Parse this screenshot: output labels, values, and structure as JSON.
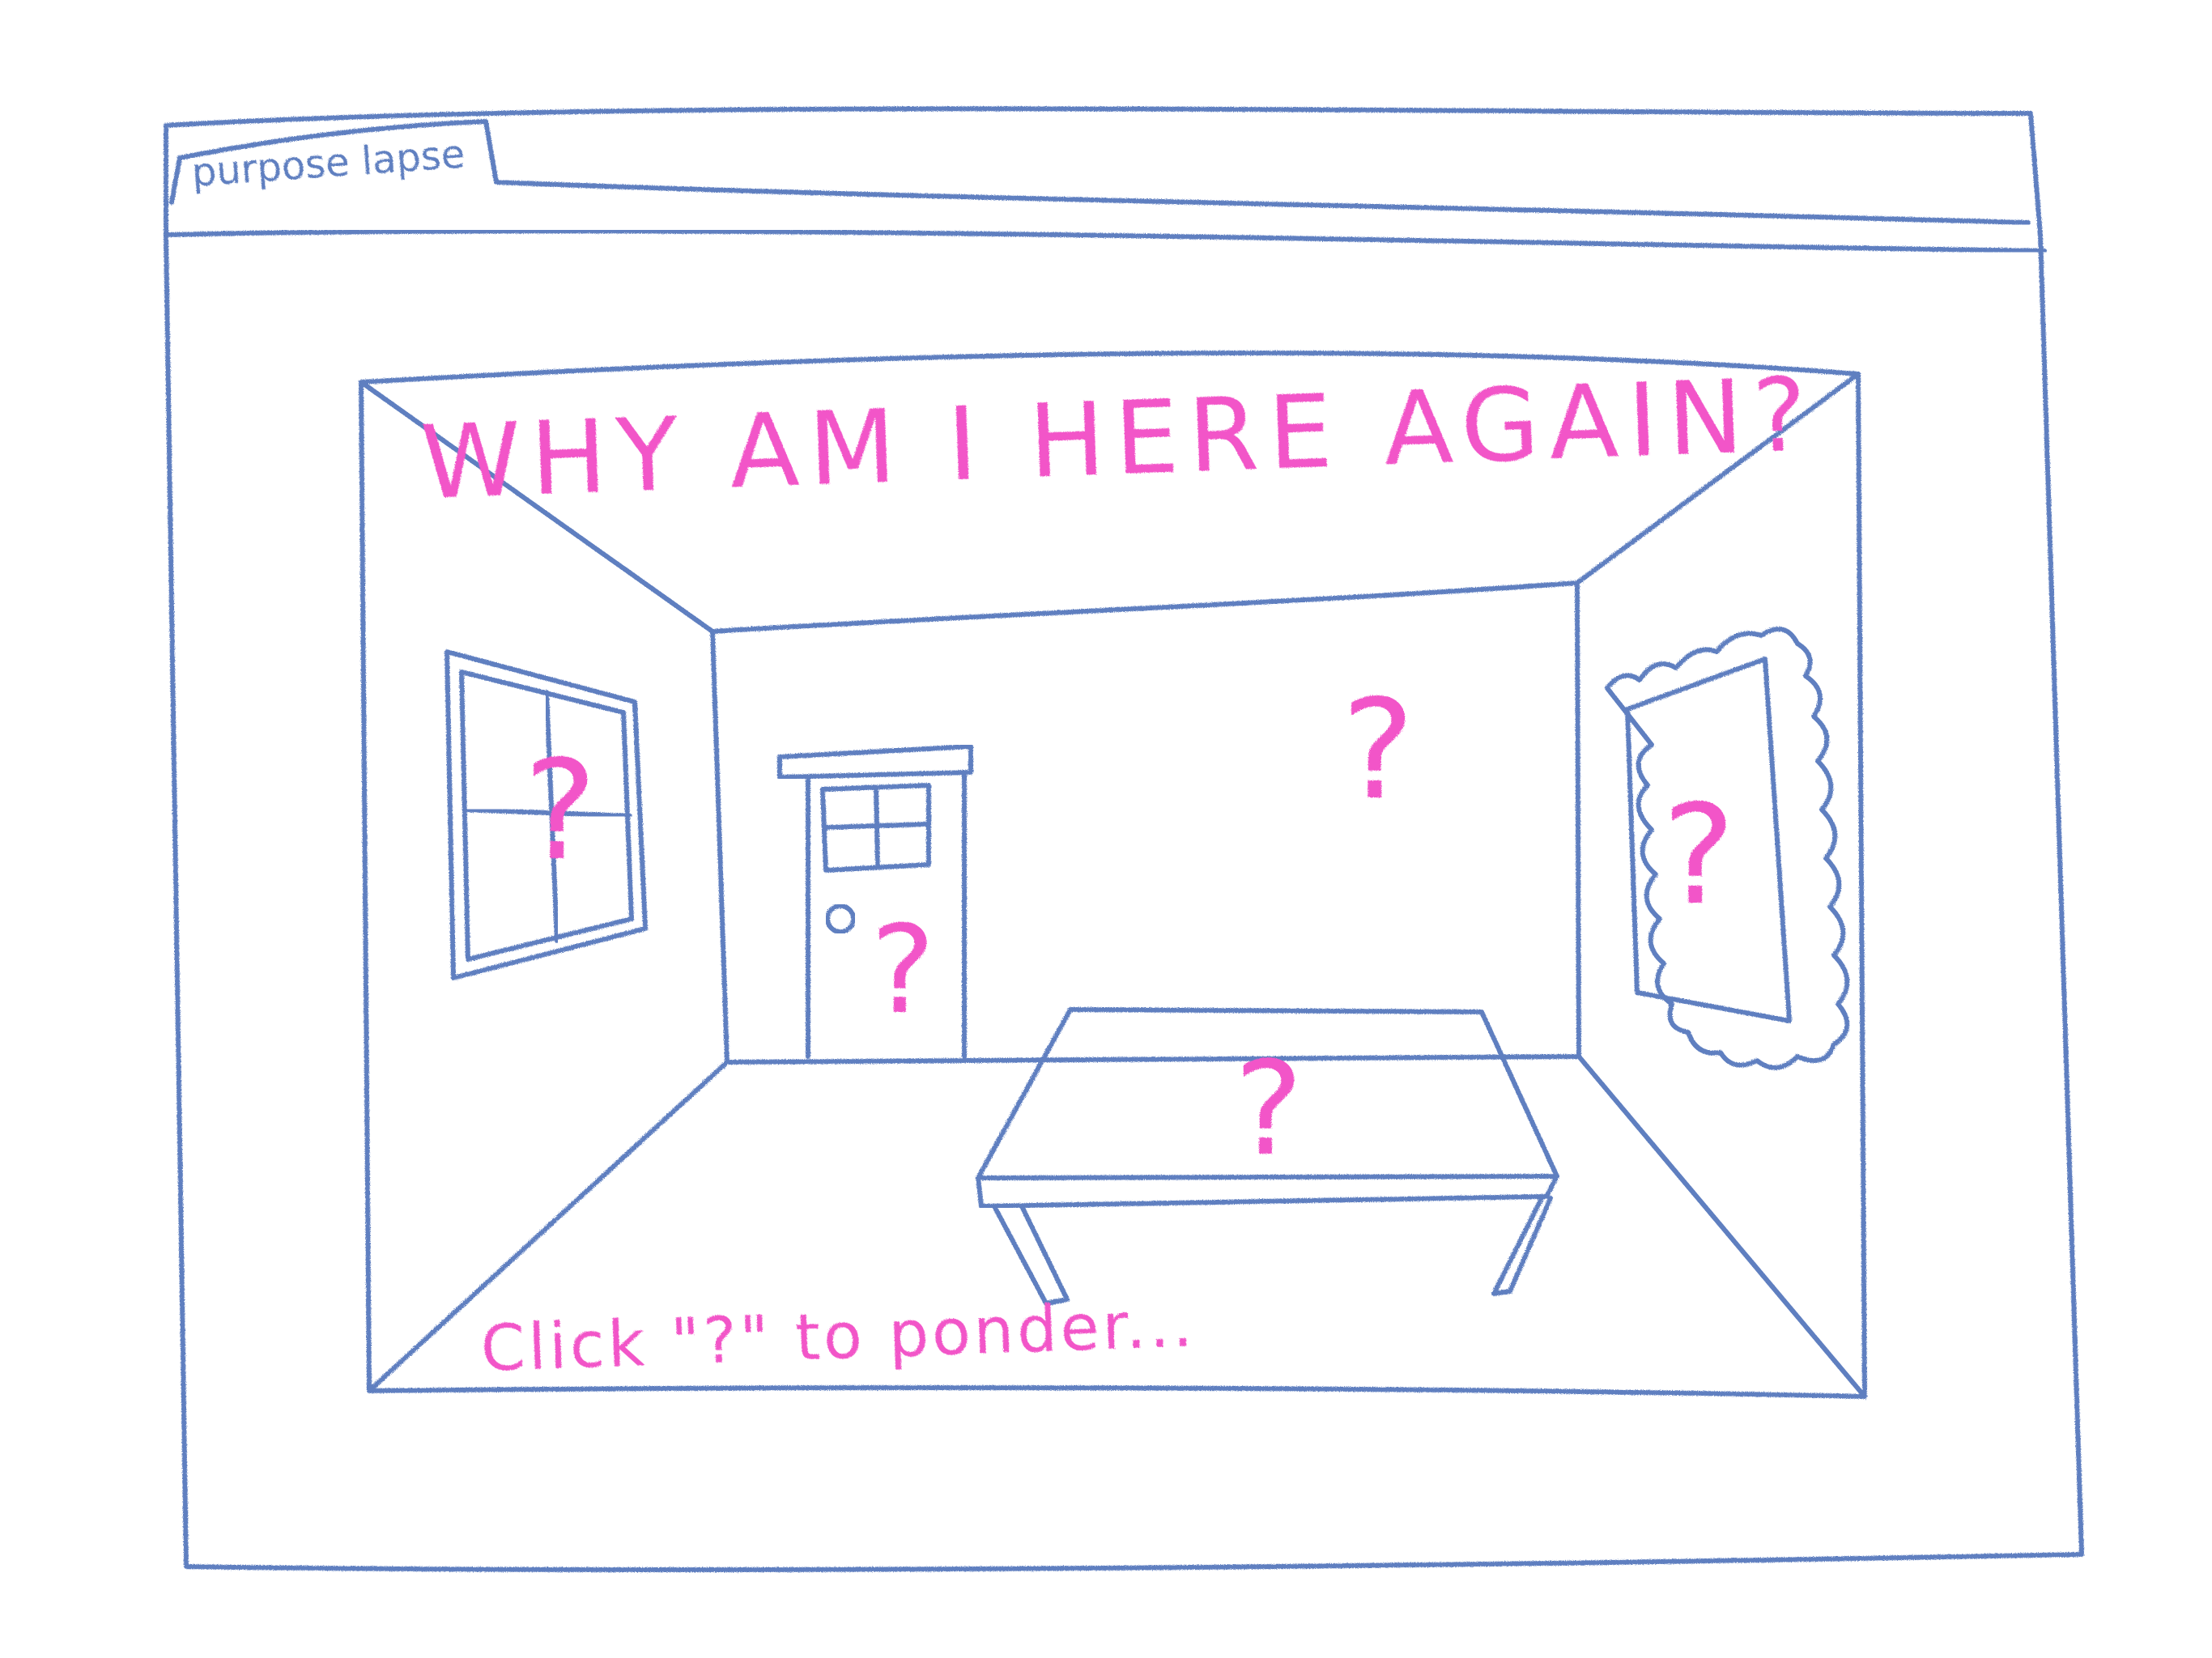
{
  "window": {
    "tab_title": "purpose lapse"
  },
  "scene": {
    "heading": "WHY AM I HERE AGAIN?",
    "instruction": "Click \"?\" to ponder...",
    "hotspots": [
      {
        "id": "window",
        "label": "?"
      },
      {
        "id": "wall",
        "label": "?"
      },
      {
        "id": "door",
        "label": "?"
      },
      {
        "id": "mirror",
        "label": "?"
      },
      {
        "id": "table",
        "label": "?"
      }
    ]
  },
  "colors": {
    "sketch": "#5f7fc0",
    "accent": "#f255c8"
  }
}
